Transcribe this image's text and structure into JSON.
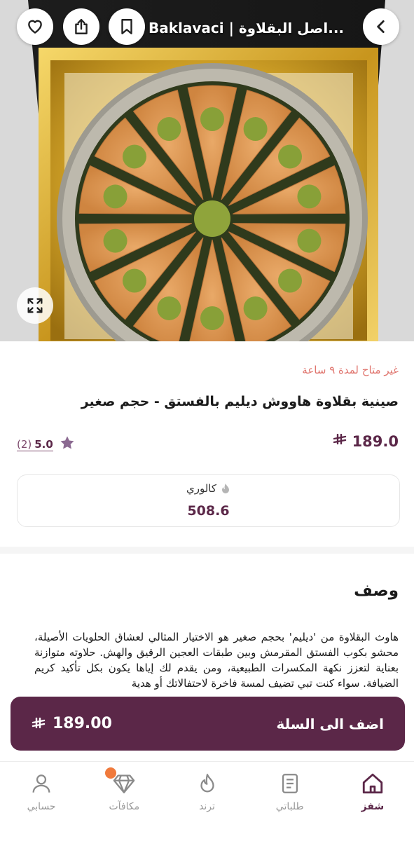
{
  "header": {
    "title": "Baklavaci | اصل البقلاوة...",
    "back_icon": "chevron-right-icon",
    "bookmark_icon": "bookmark-icon",
    "share_icon": "share-icon",
    "favorite_icon": "heart-icon",
    "expand_icon": "expand-icon"
  },
  "product": {
    "availability": "غير متاح لمدة ٩ ساعة",
    "title": "صينية بقلاوة هاووش ديليم بالفستق - حجم صغير",
    "price": "189.0",
    "currency_symbol": "⃁",
    "rating_value": "5.0",
    "rating_count": "(2)",
    "calorie_label": "كالوري",
    "calorie_value": "508.6"
  },
  "description": {
    "title": "وصف",
    "text": "هاوث البقلاوة من 'ديليم' بحجم صغير هو الاختيار المثالي لعشاق الحلويات الأصيلة، محشو بكوب الفستق المقرمش وبين طبقات العجين الرقيق والهش. حلاوته متوازنة بعناية لتعزز نكهة المكسرات الطبيعية، ومن يقدم لك إياها يكون بكل تأكيد كريم الضيافة. سواء كنت تبي تضيف لمسة فاخرة لاحتفالاتك أو هدية"
  },
  "cart": {
    "label": "اضف الى السلة",
    "price": "189.00"
  },
  "nav": {
    "items": [
      {
        "label": "حسابي",
        "icon": "user-icon"
      },
      {
        "label": "مكافآت",
        "icon": "diamond-icon"
      },
      {
        "label": "ترند",
        "icon": "flame-icon"
      },
      {
        "label": "طلباتي",
        "icon": "receipt-icon"
      },
      {
        "label": "شفز",
        "icon": "home-icon"
      }
    ]
  },
  "colors": {
    "brand": "#5b2748",
    "availability": "#e0766f",
    "notification": "#f07a3c"
  }
}
